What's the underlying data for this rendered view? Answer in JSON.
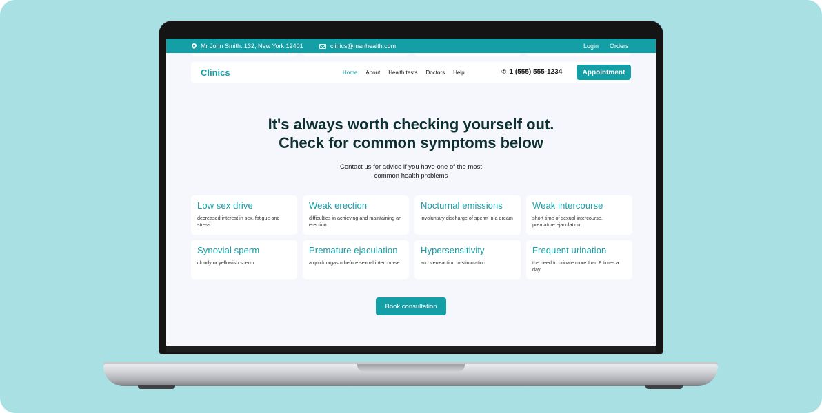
{
  "topbar": {
    "address": "Mr John Smith. 132,  New York 12401",
    "email": "clinics@manhealth.com",
    "login": "Login",
    "orders": "Orders"
  },
  "nav": {
    "logo": "Clinics",
    "items": [
      "Home",
      "About",
      "Health tests",
      "Doctors",
      "Help"
    ],
    "active_item": "Home",
    "phone": "1 (555) 555-1234",
    "appointment_label": "Appointment"
  },
  "hero": {
    "title_line1": "It's always worth checking yourself out.",
    "title_line2": "Check for common symptoms below",
    "subtitle": "Contact us for advice if you have one of the most common health problems"
  },
  "cards": [
    {
      "title": "Low sex drive",
      "desc": "decreased interest in sex, fatigue and stress"
    },
    {
      "title": "Weak erection",
      "desc": "difficulties in achieving and maintaining an erection"
    },
    {
      "title": "Nocturnal emissions",
      "desc": "involuntary discharge of sperm in a dream"
    },
    {
      "title": "Weak intercourse",
      "desc": "short time of sexual intercourse, premature ejaculation"
    },
    {
      "title": "Synovial sperm",
      "desc": "cloudy or yellowish sperm"
    },
    {
      "title": "Premature ejaculation",
      "desc": "a quick orgasm before sexual intercourse"
    },
    {
      "title": "Hypersensitivity",
      "desc": "an overreaction to stimulation"
    },
    {
      "title": "Frequent urination",
      "desc": "the need to urinate more than 8 times a day"
    }
  ],
  "cta": {
    "book_label": "Book consultation"
  },
  "colors": {
    "accent": "#149ea6",
    "background": "#a9e0e3",
    "screen_bg": "#f5f7fc",
    "heading": "#0e3032"
  },
  "icons": {
    "address": "location-pin-icon",
    "email": "envelope-icon",
    "phone": "phone-icon"
  }
}
